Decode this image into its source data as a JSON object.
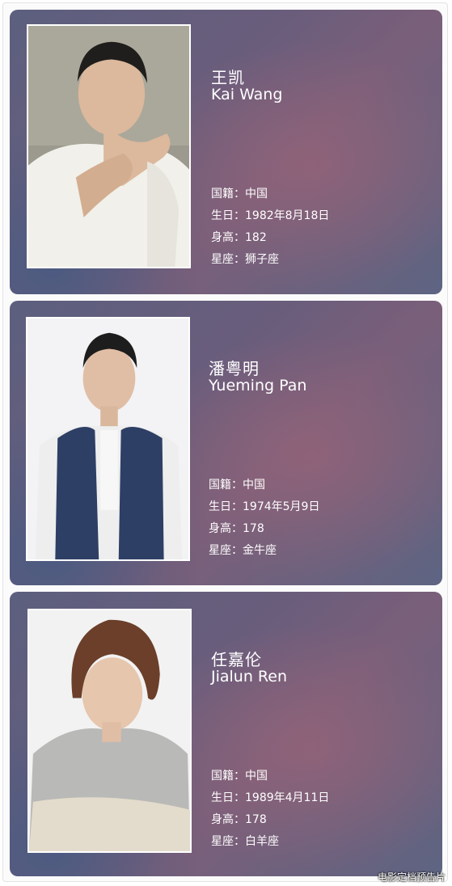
{
  "cards": [
    {
      "name_cn": "王凯",
      "name_en": "Kai Wang",
      "nationality_label": "国籍：",
      "nationality": "中国",
      "birthday_label": "生日：",
      "birthday": "1982年8月18日",
      "height_label": "身高：",
      "height": "182",
      "zodiac_label": "星座：",
      "zodiac": "狮子座"
    },
    {
      "name_cn": "潘粤明",
      "name_en": "Yueming Pan",
      "nationality_label": "国籍：",
      "nationality": "中国",
      "birthday_label": "生日：",
      "birthday": "1974年5月9日",
      "height_label": "身高：",
      "height": "178",
      "zodiac_label": "星座：",
      "zodiac": "金牛座"
    },
    {
      "name_cn": "任嘉伦",
      "name_en": "Jialun Ren",
      "nationality_label": "国籍：",
      "nationality": "中国",
      "birthday_label": "生日：",
      "birthday": "1989年4月11日",
      "height_label": "身高：",
      "height": "178",
      "zodiac_label": "星座：",
      "zodiac": "白羊座"
    }
  ],
  "watermark": "电影定档预告片"
}
